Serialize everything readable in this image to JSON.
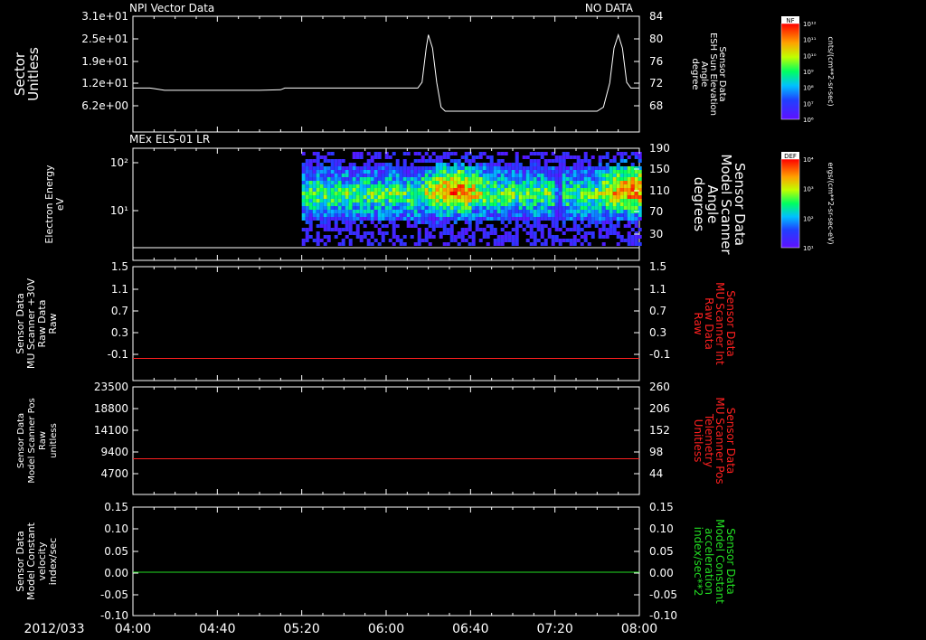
{
  "colors": {
    "white": "#ffffff",
    "red": "#ff2020",
    "green": "#22dd22",
    "background": "#000000"
  },
  "chart_data": [
    {
      "type": "line",
      "title": "NPI Vector Data",
      "status": "NO DATA",
      "ylabel": "Sector\nUnitless",
      "ytick_labels": [
        "3.1e+01",
        "2.5e+01",
        "1.9e+01",
        "1.2e+01",
        "6.2e+00"
      ],
      "y2label": "Sensor Data\nESH Sun Elevation\nAngle\ndegree",
      "y2tick_labels": [
        "84",
        "80",
        "76",
        "72",
        "68"
      ],
      "ylim": [
        64,
        84
      ],
      "x": [
        "04:00",
        "04:08",
        "04:10",
        "04:15",
        "04:30",
        "05:00",
        "05:10",
        "05:12",
        "05:30",
        "06:00",
        "06:15",
        "06:17",
        "06:19",
        "06:20",
        "06:22",
        "06:24",
        "06:26",
        "06:28",
        "06:30",
        "06:45",
        "07:00",
        "07:20",
        "07:40",
        "07:43",
        "07:46",
        "07:48",
        "07:50",
        "07:52",
        "07:54",
        "07:56",
        "08:00"
      ],
      "values": [
        71.6,
        71.6,
        71.5,
        71.2,
        71.2,
        71.2,
        71.3,
        71.6,
        71.6,
        71.6,
        71.6,
        72.6,
        78.5,
        80.8,
        78.5,
        72.5,
        68.3,
        67.6,
        67.6,
        67.6,
        67.6,
        67.6,
        67.6,
        68.3,
        72.5,
        78.5,
        80.8,
        78.5,
        72.6,
        71.6,
        71.6
      ],
      "series_color": "#ffffff",
      "colorbar": {
        "label": "NF",
        "unit": "cnts/(cm**2-sr-sec)",
        "tick_labels": [
          "10¹²",
          "10¹¹",
          "10¹⁰",
          "10⁹",
          "10⁸",
          "10⁷",
          "10⁶"
        ]
      }
    },
    {
      "type": "heatmap",
      "title": "MEx ELS-01 LR",
      "ylabel": "Electron Energy\neV",
      "ytick_labels": [
        "10²",
        "10¹"
      ],
      "y2label": "Sensor Data\nModel Scanner\nAngle\ndegrees",
      "y2tick_labels": [
        "190",
        "150",
        "110",
        "70",
        "30"
      ],
      "data_start": "05:20",
      "data_end": "08:00",
      "gap_at": "07:21",
      "hot_spots": [
        "06:32",
        "07:55"
      ],
      "line_value": 2,
      "colorbar": {
        "label": "DEF",
        "unit": "ergs/(cm**2-sr-sec-eV)",
        "tick_labels": [
          "10⁴",
          "10³",
          "10²",
          "10¹"
        ]
      }
    },
    {
      "type": "line",
      "ylabel": "Sensor Data\nMU Scanner +30V\nRaw Data\nRaw",
      "ytick_labels": [
        "1.5",
        "1.1",
        "0.7",
        "0.3",
        "-0.1"
      ],
      "y2label": "Sensor Data\nMU Scanner Int\nRaw Data\nRaw",
      "y2tick_labels": [
        "1.5",
        "1.1",
        "0.7",
        "0.3",
        "-0.1"
      ],
      "ylim": [
        -0.4,
        1.5
      ],
      "values": [
        -0.03
      ],
      "series_color": "#ff2020"
    },
    {
      "type": "line",
      "ylabel": "Sensor Data\nModel Scanner Pos\nRaw\nunitless",
      "ytick_labels": [
        "23500",
        "18800",
        "14100",
        "9400",
        "4700"
      ],
      "y2label": "Sensor Data\nMU Scanner Pos\nTelemetry\nUnitless",
      "y2tick_labels": [
        "260",
        "206",
        "152",
        "98",
        "44"
      ],
      "ylim": [
        0,
        23500
      ],
      "values": [
        7800
      ],
      "series_color": "#ff2020"
    },
    {
      "type": "line",
      "ylabel": "Sensor Data\nModel Constant\nvelocity\nindex/sec",
      "ytick_labels": [
        "0.15",
        "0.10",
        "0.05",
        "0.00",
        "-0.05",
        "-0.10"
      ],
      "y2label": "Sensor Data\nModel Constant\nacceleration\nindex/sec**2",
      "y2tick_labels": [
        "0.15",
        "0.10",
        "0.05",
        "0.00",
        "-0.05",
        "-0.10"
      ],
      "ylim": [
        -0.1,
        0.15
      ],
      "values": [
        0.0
      ],
      "series_color": "#22dd22"
    }
  ],
  "x_axis": {
    "date_label": "2012/033",
    "tick_labels": [
      "04:00",
      "04:40",
      "05:20",
      "06:00",
      "06:40",
      "07:20",
      "08:00"
    ]
  }
}
